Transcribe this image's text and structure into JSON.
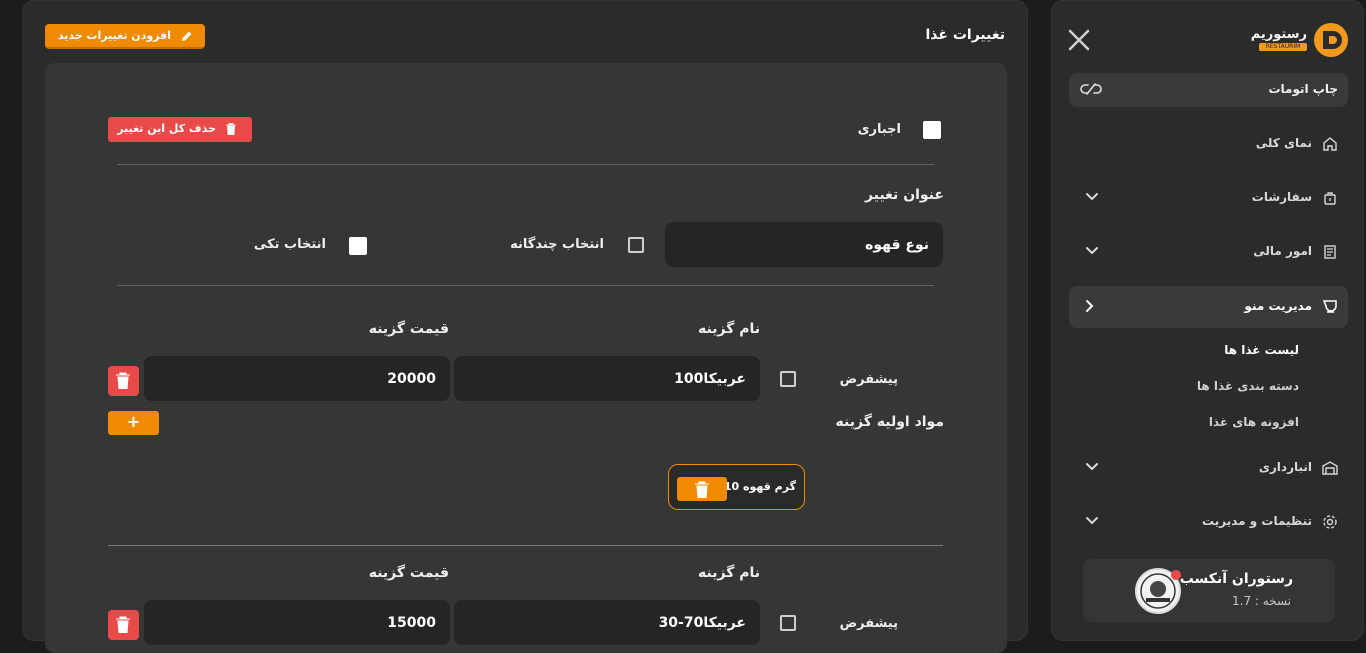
{
  "sidebar": {
    "brand": "رستوریم",
    "brand_sub": "RESTAURIM",
    "auto_print": "چاپ اتومات",
    "nav": [
      {
        "label": "نمای کلی",
        "icon": "home-icon"
      },
      {
        "label": "سفارشات",
        "icon": "bag-icon"
      },
      {
        "label": "امور مالی",
        "icon": "receipt-icon"
      },
      {
        "label": "مدیریت منو",
        "icon": "menu-board-icon"
      },
      {
        "label": "انبارداری",
        "icon": "warehouse-icon"
      },
      {
        "label": "تنظیمات و مدیریت",
        "icon": "gear-icon"
      }
    ],
    "submenu": [
      "لیست غذا ها",
      "دسته بندی غذا ها",
      "افزونه های غذا"
    ],
    "profile": {
      "name": "رستوران آنکسب",
      "version": "نسخه : 1.7"
    }
  },
  "main": {
    "title": "تغییرات غذا",
    "add_button": "افزودن تغییرات جدید",
    "required_label": "اجباری",
    "delete_all": "حذف کل این تغییر",
    "change_title_label": "عنوان تغییر",
    "change_title_value": "نوع قهوه",
    "multi_select": "انتخاب چندگانه",
    "single_select": "انتخاب تکی",
    "option_name_header": "نام گزینه",
    "option_price_header": "قیمت گزینه",
    "default_label": "پیشفرض",
    "ingredients_label": "مواد اولیه گزینه",
    "plus": "+",
    "options": [
      {
        "name": "100عربیکا",
        "price": "20000",
        "ingredient": "10 گرم قهوه"
      },
      {
        "name": "30-70عربیکا",
        "price": "15000"
      }
    ]
  },
  "colors": {
    "accent": "#f08a00",
    "danger": "#e84a4a",
    "panel": "#2b2b2b",
    "card": "#363636",
    "input": "#252525"
  }
}
